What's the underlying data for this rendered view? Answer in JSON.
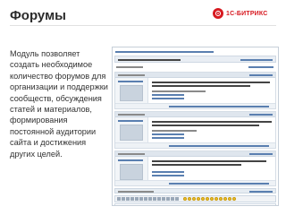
{
  "slide": {
    "title": "Форумы",
    "description": "Модуль позволяет создать необходимое количество форумов для организации и поддержки сообществ, обсуждения статей и материалов, формирования постоянной аудитории сайта и достижения других целей."
  },
  "brand": {
    "name": "1С-БИТРИКС",
    "logo_icon": "bitrix-logo-icon",
    "color": "#d71920"
  },
  "forum_screenshot": {
    "posts_count": 3,
    "toolbar_buttons": 14,
    "smileys": 12
  }
}
